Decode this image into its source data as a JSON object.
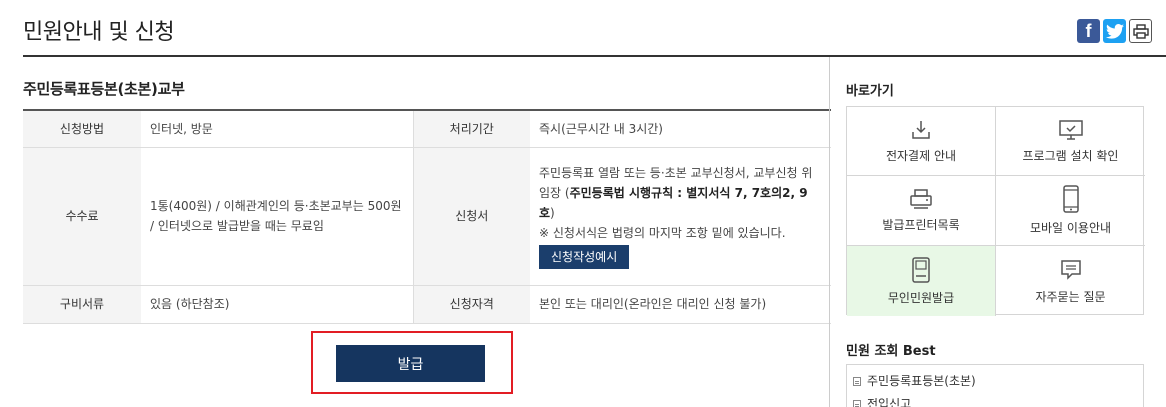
{
  "page": {
    "title": "민원안내 및 신청"
  },
  "share": {
    "facebook_label": "f"
  },
  "service": {
    "title": "주민등록표등본(초본)교부",
    "table": {
      "method_label": "신청방법",
      "method_value": "인터넷, 방문",
      "period_label": "처리기간",
      "period_value": "즉시(근무시간 내 3시간)",
      "fee_label": "수수료",
      "fee_value": "1통(400원) / 이해관계인의 등·초본교부는 500원 / 인터넷으로 발급받을 때는 무료임",
      "form_label": "신청서",
      "form_text_1": "주민등록표 열람 또는 등·초본 교부신청서, 교부신청 위임장 (",
      "form_text_bold": "주민등록법 시행규칙 : 별지서식 7, 7호의2, 9호",
      "form_text_2": ")",
      "form_note": "※ 신청서식은 법령의 마지막 조항 밑에 있습니다.",
      "sample_button": "신청작성예시",
      "docs_label": "구비서류",
      "docs_value": "있음 (하단참조)",
      "eligibility_label": "신청자격",
      "eligibility_value": "본인 또는 대리인(온라인은 대리인 신청 불가)"
    },
    "issue_button": "발급"
  },
  "sidebar": {
    "shortcut_title": "바로가기",
    "shortcuts": [
      {
        "label": "전자결제 안내",
        "icon": "download-tray-icon"
      },
      {
        "label": "프로그램 설치 확인",
        "icon": "monitor-check-icon"
      },
      {
        "label": "발급프린터목록",
        "icon": "printer-icon"
      },
      {
        "label": "모바일 이용안내",
        "icon": "mobile-icon"
      },
      {
        "label": "무인민원발급",
        "icon": "kiosk-icon",
        "active": true
      },
      {
        "label": "자주묻는 질문",
        "icon": "speech-bubble-icon"
      }
    ],
    "best_title": "민원 조회 Best",
    "best_items": [
      "주민등록표등본(초본)",
      "전입신고"
    ]
  },
  "colors": {
    "accent_navy": "#15355f",
    "highlight_red": "#e21d24",
    "active_green": "#e8f8e6",
    "facebook": "#3b5998",
    "twitter": "#1da1f2"
  }
}
